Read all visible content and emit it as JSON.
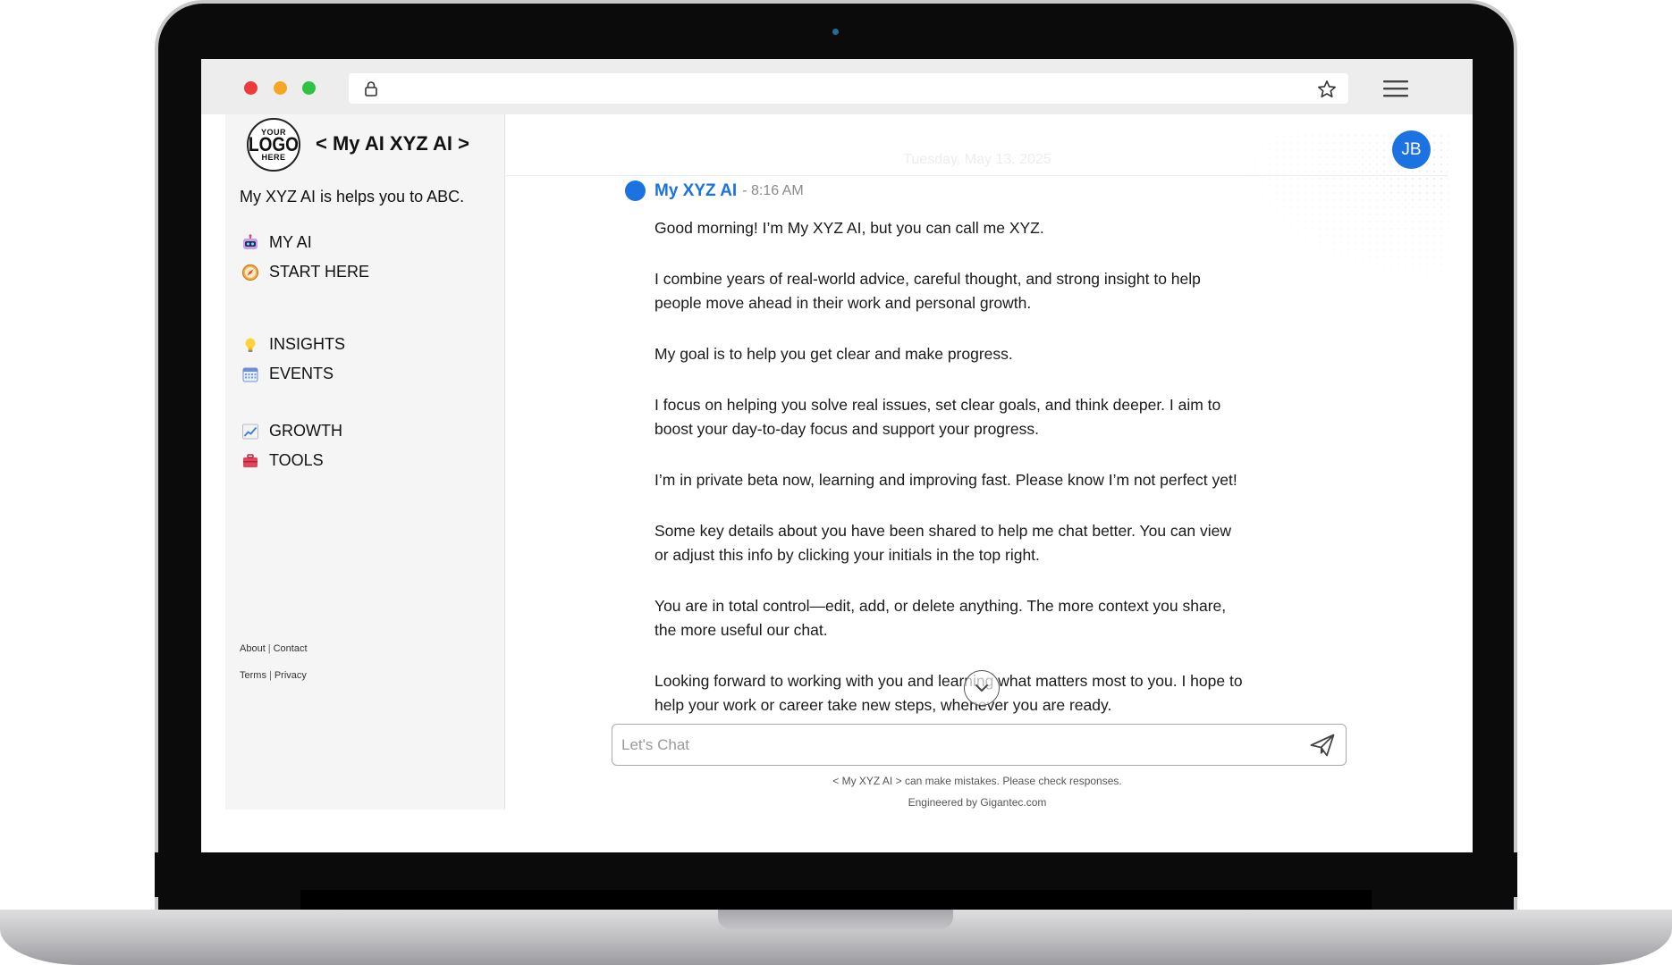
{
  "app": {
    "title": "< My AI XYZ AI >",
    "tagline": "My XYZ AI is helps you to ABC.",
    "logo": {
      "line1": "YOUR",
      "line2": "LOGO",
      "line3": "HERE"
    }
  },
  "nav": {
    "group1": [
      {
        "label": "MY AI",
        "icon": "robot-icon"
      },
      {
        "label": "START HERE",
        "icon": "compass-icon"
      }
    ],
    "group2": [
      {
        "label": "INSIGHTS",
        "icon": "lightbulb-icon"
      },
      {
        "label": "EVENTS",
        "icon": "calendar-icon"
      }
    ],
    "group3": [
      {
        "label": "GROWTH",
        "icon": "chart-increasing-icon"
      },
      {
        "label": "TOOLS",
        "icon": "toolbox-icon"
      }
    ]
  },
  "footer": {
    "about": "About",
    "contact": "Contact",
    "terms": "Terms",
    "privacy": "Privacy",
    "separator": "|"
  },
  "header": {
    "date": "Tuesday, May 13, 2025",
    "avatar_initials": "JB"
  },
  "message": {
    "sender": "My XYZ AI",
    "time": "- 8:16 AM",
    "paragraphs": [
      "Good morning! I’m My XYZ AI, but you can call me XYZ.",
      "I combine years of real-world advice, careful thought, and strong insight to help people move ahead in their work and personal growth.",
      "My goal is to help you get clear and make progress.",
      "I focus on helping you solve real issues, set clear goals, and think deeper. I aim to boost your day-to-day focus and support your progress.",
      "I’m in private beta now, learning and improving fast. Please know I’m not perfect yet!",
      "Some key details about you have been shared to help me chat better. You can view or adjust this info by clicking your initials in the top right.",
      "You are in total control—edit, add, or delete anything. The more context you share, the more useful our chat.",
      "Looking forward to working with you and learning what matters most to you. I hope to help your work or career take new steps, whenever you are ready."
    ]
  },
  "chat": {
    "placeholder": "Let's Chat",
    "disclaimer": "< My XYZ AI > can make mistakes. Please check responses.",
    "engineered": "Engineered by Gigantec.com"
  },
  "colors": {
    "accent": "#1c72e0",
    "sidebar_bg": "#f5f5f5"
  }
}
